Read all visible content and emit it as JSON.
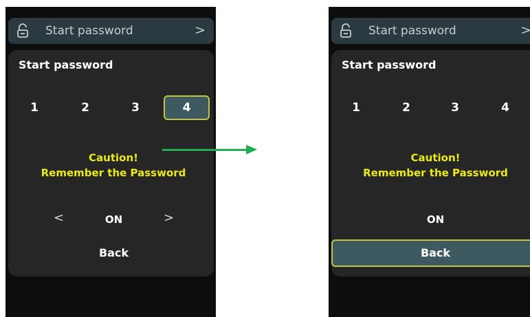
{
  "left": {
    "top_bar": {
      "label": "Start password",
      "chevron": ">"
    },
    "panel": {
      "title": "Start password",
      "digits": [
        "1",
        "2",
        "3",
        "4"
      ],
      "selected_digit_index": 3,
      "caution_line1": "Caution!",
      "caution_line2": "Remember the Password",
      "arrow_left": "<",
      "value": "ON",
      "arrow_right": ">",
      "back": "Back"
    }
  },
  "right": {
    "top_bar": {
      "label": "Start password",
      "chevron": ">"
    },
    "panel": {
      "title": "Start password",
      "digits": [
        "1",
        "2",
        "3",
        "4"
      ],
      "caution_line1": "Caution!",
      "caution_line2": "Remember the Password",
      "value": "ON",
      "back": "Back"
    }
  },
  "colors": {
    "caution_text": "#eaea1a",
    "selection_border": "#c5c341",
    "selection_fill": "#3e5a61",
    "transition_arrow": "#1fae4f"
  }
}
